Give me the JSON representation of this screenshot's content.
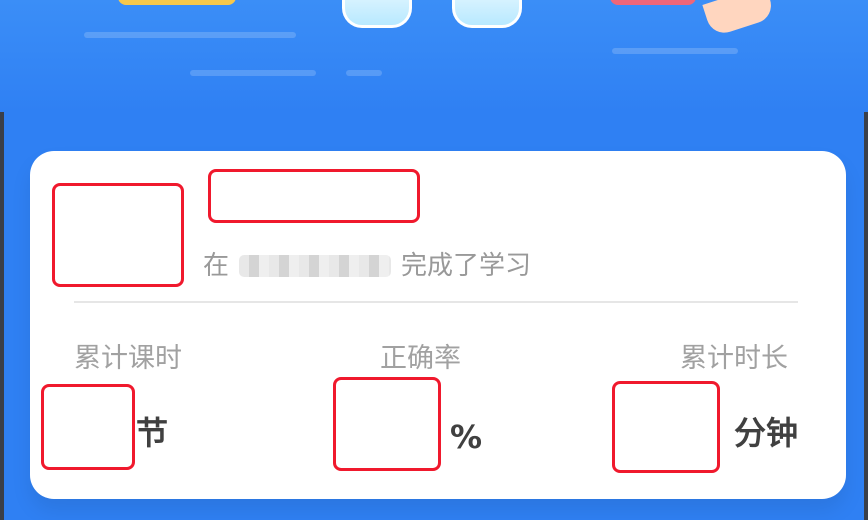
{
  "summary": {
    "text_before": "在",
    "text_after": "完成了学习"
  },
  "stats": [
    {
      "label": "累计课时",
      "unit": "节"
    },
    {
      "label": "正确率",
      "unit": "%"
    },
    {
      "label": "累计时长",
      "unit": "分钟"
    }
  ],
  "colors": {
    "background": "#2f80f3",
    "card": "#ffffff",
    "redaction_border": "#f0192d",
    "secondary_text": "#999999",
    "primary_text": "#404040"
  }
}
